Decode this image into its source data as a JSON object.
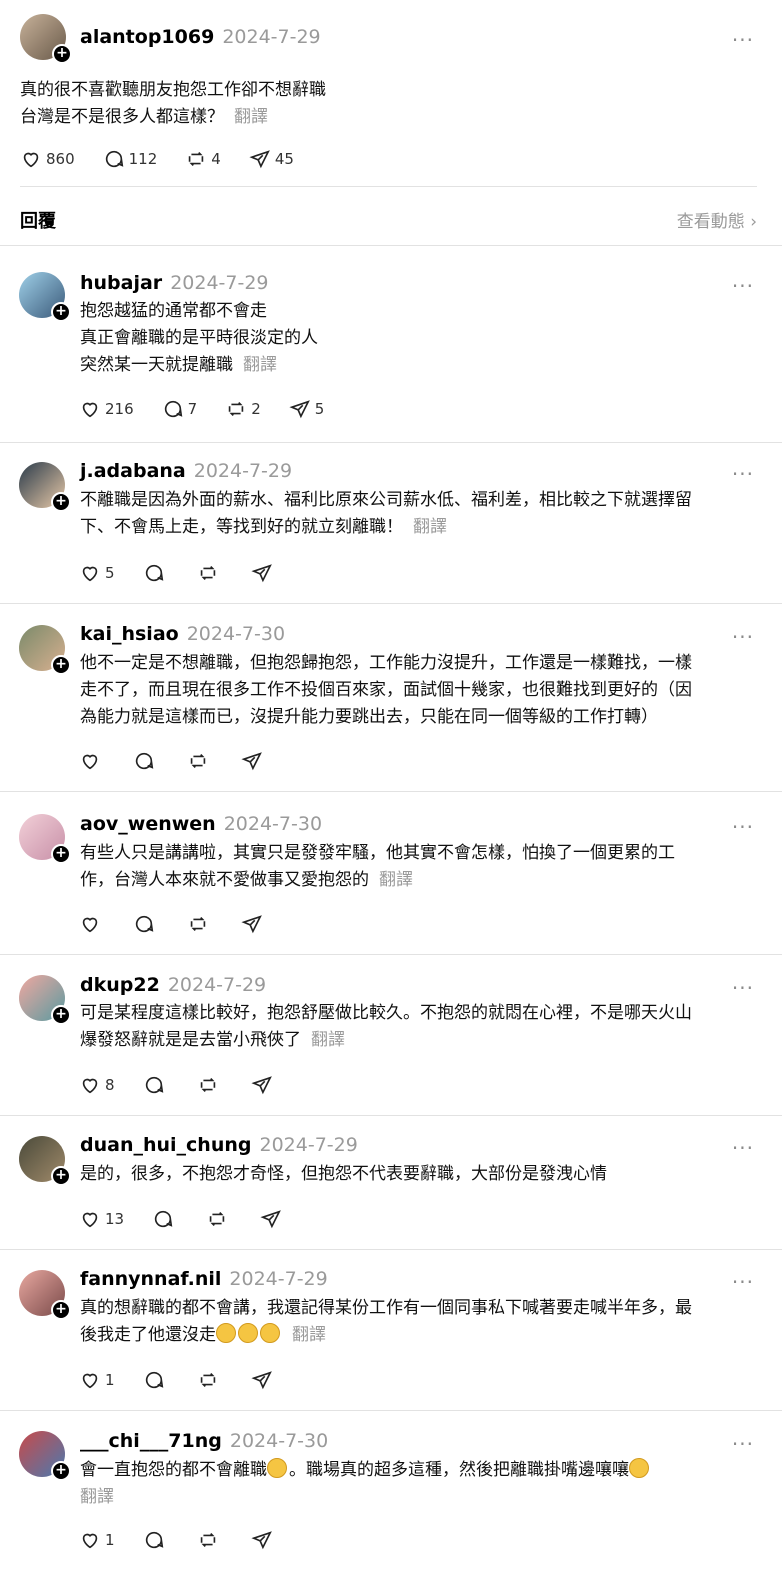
{
  "op": {
    "username": "alantop1069",
    "date": "2024-7-29",
    "lines": [
      "真的很不喜歡聽朋友抱怨工作卻不想辭職",
      "台灣是不是很多人都這樣？"
    ],
    "translate": "翻譯",
    "likes": "860",
    "replies": "112",
    "reposts": "4",
    "shares": "45"
  },
  "replies_header": {
    "label": "回覆",
    "activity_link": "查看動態"
  },
  "comments": [
    {
      "username": "hubajar",
      "date": "2024-7-29",
      "text": "抱怨越猛的通常都不會走\n真正會離職的是平時很淡定的人\n突然某一天就提離職",
      "translate": "翻譯",
      "likes": "216",
      "replies": "7",
      "reposts": "2",
      "shares": "5"
    },
    {
      "username": "j.adabana",
      "date": "2024-7-29",
      "text": "不離職是因為外面的薪水、福利比原來公司薪水低、福利差，相比較之下就選擇留\n下、不會馬上走，等找到好的就立刻離職！",
      "translate": "翻譯",
      "likes": "5",
      "replies": "",
      "reposts": "",
      "shares": ""
    },
    {
      "username": "kai_hsiao",
      "date": "2024-7-30",
      "text": "他不一定是不想離職，但抱怨歸抱怨，工作能力沒提升，工作還是一樣難找，一樣\n走不了，而且現在很多工作不投個百來家，面試個十幾家，也很難找到更好的（因\n為能力就是這樣而已，沒提升能力要跳出去，只能在同一個等級的工作打轉）",
      "translate": "",
      "likes": "",
      "replies": "",
      "reposts": "",
      "shares": ""
    },
    {
      "username": "aov_wenwen",
      "date": "2024-7-30",
      "text": "有些人只是講講啦，其實只是發發牢騷，他其實不會怎樣，怕換了一個更累的工\n作，台灣人本來就不愛做事又愛抱怨的",
      "translate": "翻譯",
      "likes": "",
      "replies": "",
      "reposts": "",
      "shares": ""
    },
    {
      "username": "dkup22",
      "date": "2024-7-29",
      "text": "可是某程度這樣比較好，抱怨舒壓做比較久。不抱怨的就悶在心裡，不是哪天火山\n爆發怒辭就是是去當小飛俠了󠄀",
      "translate": "翻譯",
      "likes": "8",
      "replies": "",
      "reposts": "",
      "shares": ""
    },
    {
      "username": "duan_hui_chung",
      "date": "2024-7-29",
      "text": "是的，很多，不抱怨才奇怪，但抱怨不代表要辭職，大部份是發洩心情",
      "translate": "",
      "likes": "13",
      "replies": "",
      "reposts": "",
      "shares": ""
    },
    {
      "username": "fannynnaf.nil",
      "date": "2024-7-29",
      "text": "真的想辭職的都不會講，我還記得某份工作有一個同事私下喊著要走喊半年多，最\n後我走了他還沒走",
      "translate": "翻譯",
      "likes": "1",
      "replies": "",
      "reposts": "",
      "shares": ""
    },
    {
      "username": "___chi___71ng",
      "date": "2024-7-30",
      "text": "會一直抱怨的都不會離職",
      "text2": "。職場真的超多這種，然後把離職掛嘴邊嚷嚷",
      "translate": "翻譯",
      "likes": "1",
      "replies": "",
      "reposts": "",
      "shares": ""
    }
  ],
  "colors": {
    "muted": "#9a9a9a",
    "divider": "#e2e2e2"
  }
}
